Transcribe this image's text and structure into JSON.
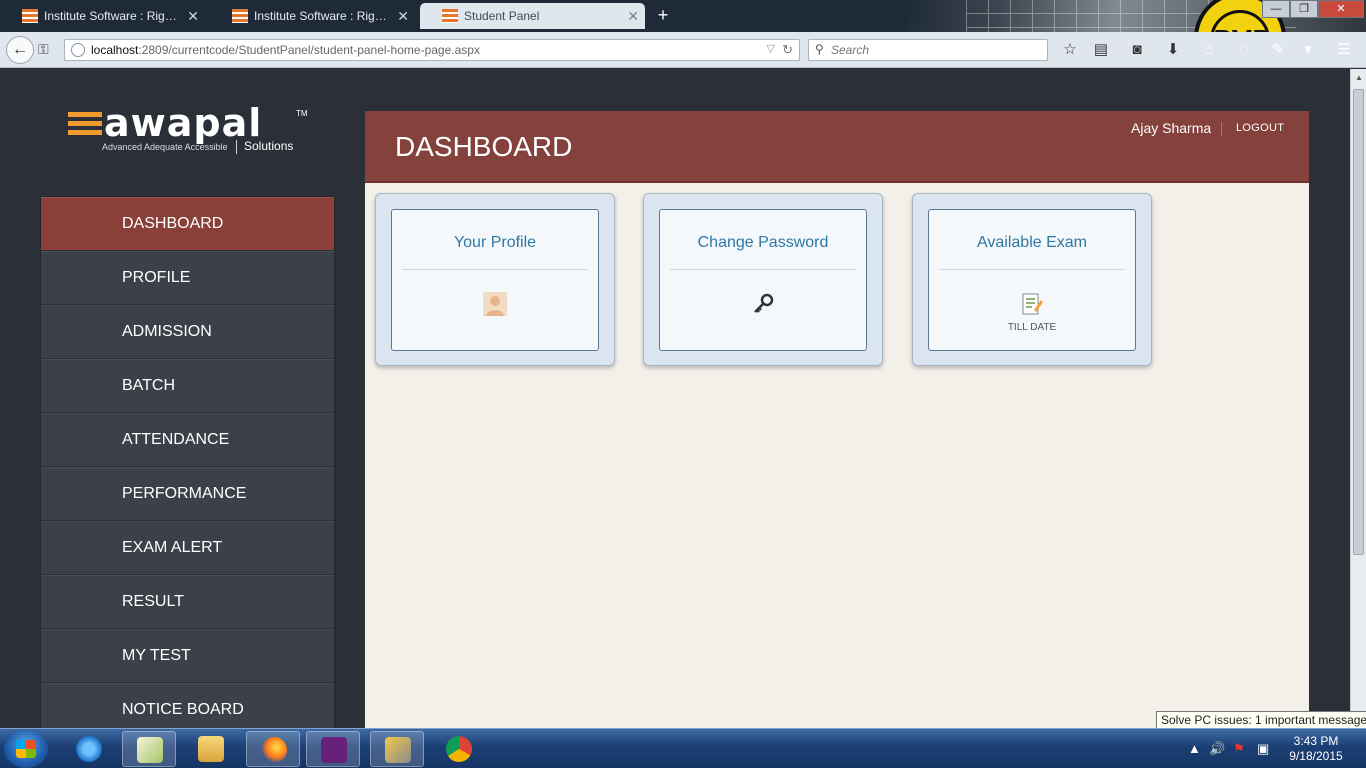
{
  "browser": {
    "tabs": [
      {
        "title": "Institute Software : Right W...",
        "active": false
      },
      {
        "title": "Institute Software : Right W...",
        "active": false
      },
      {
        "title": "Student Panel",
        "active": true
      }
    ],
    "url_host": "localhost",
    "url_rest": ":2809/currentcode/StudentPanel/student-panel-home-page.aspx",
    "search_placeholder": "Search",
    "theme_text": "BVB"
  },
  "logo": {
    "word": "awapal",
    "tm": "TM",
    "tagline": "Advanced  Adequate  Accessible",
    "solutions": "Solutions"
  },
  "sidebar": {
    "items": [
      {
        "label": "DASHBOARD",
        "active": true
      },
      {
        "label": "PROFILE"
      },
      {
        "label": "ADMISSION"
      },
      {
        "label": "BATCH"
      },
      {
        "label": "ATTENDANCE"
      },
      {
        "label": "PERFORMANCE"
      },
      {
        "label": "EXAM ALERT"
      },
      {
        "label": "RESULT"
      },
      {
        "label": "MY TEST"
      },
      {
        "label": "NOTICE BOARD"
      }
    ]
  },
  "header": {
    "title": "DASHBOARD",
    "user_name": "Ajay Sharma",
    "logout_label": "LOGOUT"
  },
  "cards": [
    {
      "title": "Your Profile",
      "icon": "user-icon",
      "subtitle": ""
    },
    {
      "title": "Change Password",
      "icon": "key-icon",
      "subtitle": ""
    },
    {
      "title": "Available Exam",
      "icon": "exam-note-icon",
      "subtitle": "TILL DATE"
    }
  ],
  "taskbar": {
    "time": "3:43 PM",
    "date": "9/18/2015",
    "notification": "Solve PC issues: 1 important message"
  },
  "colors": {
    "accent": "#85413b",
    "sidebar_bg": "#3b4049",
    "card_title": "#2f78a6",
    "content_bg": "#f3efe9"
  }
}
